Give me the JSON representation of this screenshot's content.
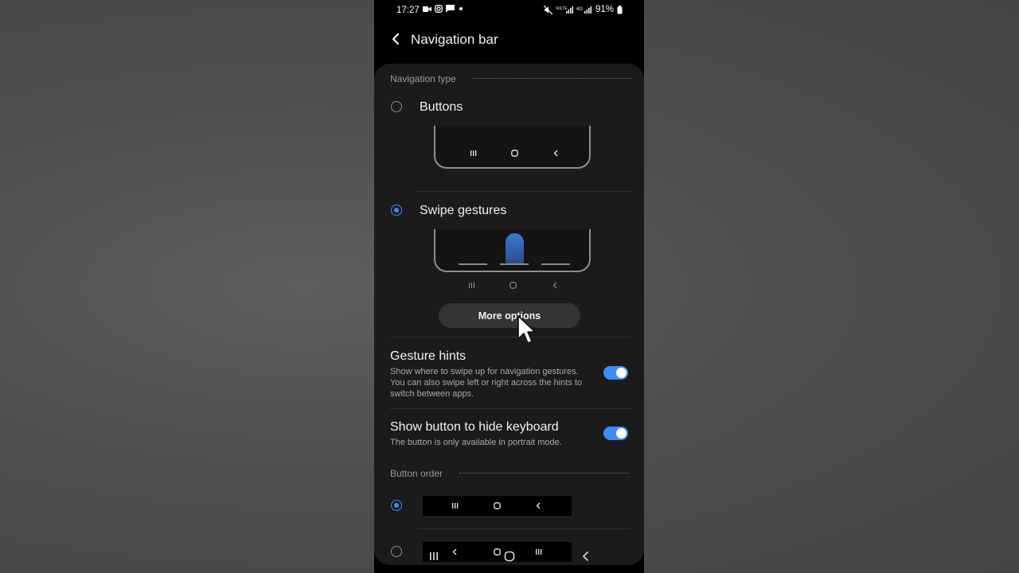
{
  "status_bar": {
    "time": "17:27",
    "notification_icons": [
      "video-call-icon",
      "instagram-icon",
      "message-icon",
      "dot-icon"
    ],
    "right_icons": [
      "mute-icon",
      "volte-signal-icon",
      "4g-signal-icon"
    ],
    "battery": "91%"
  },
  "app_bar": {
    "title": "Navigation bar"
  },
  "navigation_type": {
    "header": "Navigation type",
    "options": [
      {
        "label": "Buttons",
        "selected": false
      },
      {
        "label": "Swipe gestures",
        "selected": true
      }
    ],
    "more_options_label": "More options"
  },
  "gesture_hints": {
    "title": "Gesture hints",
    "description": "Show where to swipe up for navigation gestures. You can also swipe left or right across the hints to switch between apps.",
    "enabled": true
  },
  "hide_keyboard_button": {
    "title": "Show button to hide keyboard",
    "description": "The button is only available in portrait mode.",
    "enabled": true
  },
  "button_order": {
    "header": "Button order",
    "options": [
      {
        "order": [
          "recents",
          "home",
          "back"
        ],
        "selected": true
      },
      {
        "order": [
          "back",
          "home",
          "recents"
        ],
        "selected": false
      }
    ]
  },
  "colors": {
    "accent": "#3f8cf5",
    "card": "#1b1b1b",
    "background": "#000000"
  }
}
